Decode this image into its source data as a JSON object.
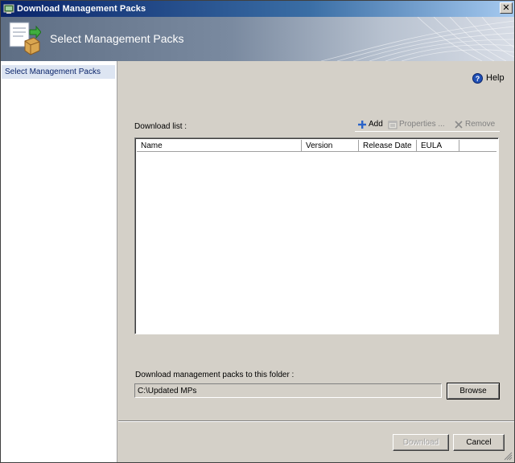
{
  "window": {
    "title": "Download Management Packs",
    "close_glyph": "✕"
  },
  "banner": {
    "title": "Select Management Packs",
    "icon": "management-pack-icon"
  },
  "nav": {
    "items": [
      {
        "label": "Select Management Packs",
        "selected": true
      }
    ]
  },
  "help": {
    "label": "Help",
    "icon": "help-icon"
  },
  "download_list": {
    "label": "Download list :",
    "toolbar": {
      "add": "Add",
      "properties": "Properties ...",
      "remove": "Remove"
    },
    "columns": [
      "Name",
      "Version",
      "Release Date",
      "EULA"
    ],
    "rows": []
  },
  "folder": {
    "label": "Download management packs to this folder :",
    "value": "C:\\Updated MPs",
    "browse": "Browse"
  },
  "footer": {
    "download": "Download",
    "cancel": "Cancel"
  },
  "colors": {
    "accent": "#0a246a",
    "face": "#d4d0c8",
    "nav_selected": "#dde5f2"
  }
}
